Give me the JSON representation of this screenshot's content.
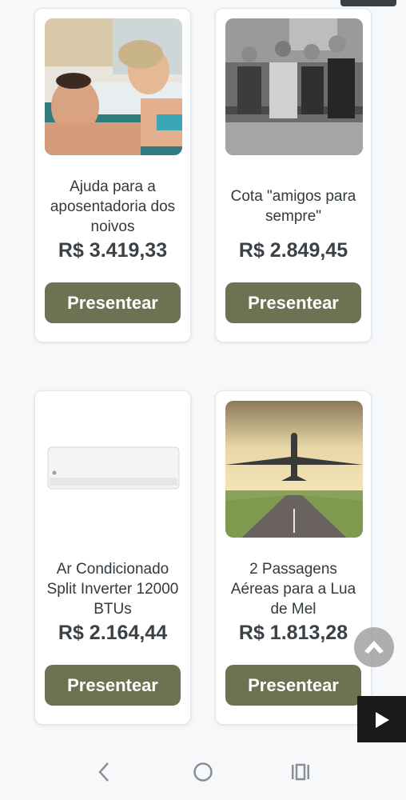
{
  "products": [
    {
      "title": "Ajuda para a aposentadoria dos noivos",
      "price": "R$ 3.419,33",
      "button": "Presentear",
      "image": "couple-relaxing-photo"
    },
    {
      "title": "Cota \"amigos para sempre\"",
      "price": "R$ 2.849,45",
      "button": "Presentear",
      "image": "old-friends-bench-photo"
    },
    {
      "title": "Ar Condicionado Split Inverter 12000 BTUs",
      "price": "R$ 2.164,44",
      "button": "Presentear",
      "image": "air-conditioner-photo"
    },
    {
      "title": "2 Passagens Aéreas para a Lua de Mel",
      "price": "R$ 1.813,28",
      "button": "Presentear",
      "image": "airplane-runway-photo"
    }
  ],
  "colors": {
    "button": "#6b7352",
    "price": "#3c4146",
    "background": "#f7f8fa"
  },
  "icons": {
    "scroll_top": "chevron-up-icon",
    "play": "play-icon",
    "nav_back": "back-icon",
    "nav_home": "home-icon",
    "nav_recents": "recents-icon"
  }
}
